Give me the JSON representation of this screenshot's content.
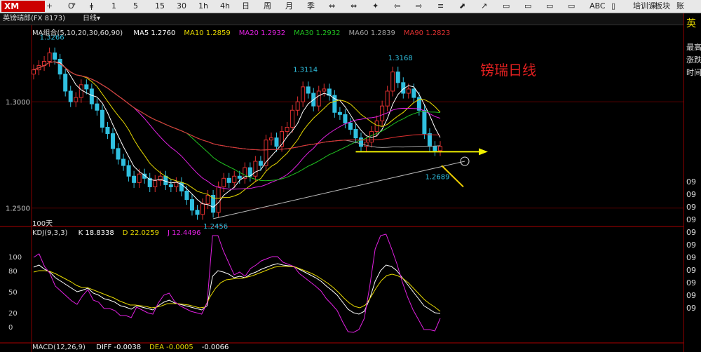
{
  "toolbar": {
    "logo": "XM",
    "items": [
      "+",
      "Ꝍ",
      "ǂ",
      "1",
      "5",
      "15",
      "30",
      "1h",
      "4h",
      "日",
      "周",
      "月",
      "季",
      "⇔",
      "⇔",
      "✦",
      "⇦",
      "⇨",
      "≡",
      "⬈",
      "↗",
      "▭",
      "▭",
      "▭",
      "▭",
      "ABC",
      "▯",
      "培训课",
      "板块",
      "账"
    ]
  },
  "titlebar": {
    "symbol": "英镑瑞郎(FX 8173)",
    "period": "日线▾"
  },
  "ma_legend": {
    "label": "MA组合(5,10,20,30,60,90)",
    "items": [
      {
        "text": "MA5 1.2760",
        "color": "#ffffff"
      },
      {
        "text": "MA10 1.2859",
        "color": "#e6d800"
      },
      {
        "text": "MA20 1.2932",
        "color": "#e020e0"
      },
      {
        "text": "MA30 1.2932",
        "color": "#20c020"
      },
      {
        "text": "MA60 1.2839",
        "color": "#a0a0a0"
      },
      {
        "text": "MA90 1.2823",
        "color": "#e03030"
      }
    ]
  },
  "annotation": {
    "text": "镑瑞日线",
    "color": "#e02020"
  },
  "range_label": "100天",
  "kdj_legend": {
    "label": "KDJ(9,3,3)",
    "items": [
      {
        "text": "K 18.8338",
        "color": "#ffffff"
      },
      {
        "text": "D 22.0259",
        "color": "#e6d800"
      },
      {
        "text": "J 12.4496",
        "color": "#e020e0"
      }
    ]
  },
  "macd_legend": {
    "label": "MACD(12,26,9)",
    "items": [
      {
        "text": "DIFF -0.0038",
        "color": "#ffffff"
      },
      {
        "text": "DEA -0.0005",
        "color": "#e6d800"
      },
      {
        "text": "-0.0066",
        "color": "#ffffff"
      }
    ]
  },
  "right_panel": [
    "英",
    "最高",
    "涨跌",
    "时间",
    "09",
    "09",
    "09",
    "09",
    "09",
    "09",
    "09",
    "09",
    "09",
    "09",
    "09"
  ],
  "chart_data": {
    "type": "candlestick",
    "price_axis": {
      "ticks": [
        1.3,
        1.25
      ],
      "tick_labels": [
        "1.3000",
        "1.2500"
      ],
      "ylim": [
        1.242,
        1.334
      ]
    },
    "price_labels": [
      {
        "text": "1.3266",
        "value": 1.3266,
        "index": 3
      },
      {
        "text": "1.3114",
        "value": 1.3114,
        "index": 51
      },
      {
        "text": "1.3168",
        "value": 1.3168,
        "index": 69
      },
      {
        "text": "1.2689",
        "value": 1.2689,
        "index": 76
      },
      {
        "text": "1.2456",
        "value": 1.2456,
        "index": 34
      }
    ],
    "closes": [
      1.315,
      1.317,
      1.319,
      1.323,
      1.32,
      1.313,
      1.305,
      1.3,
      1.302,
      1.308,
      1.306,
      1.299,
      1.296,
      1.288,
      1.285,
      1.278,
      1.273,
      1.27,
      1.265,
      1.262,
      1.266,
      1.264,
      1.26,
      1.263,
      1.265,
      1.261,
      1.26,
      1.262,
      1.258,
      1.254,
      1.249,
      1.247,
      1.252,
      1.256,
      1.248,
      1.26,
      1.264,
      1.262,
      1.265,
      1.264,
      1.269,
      1.265,
      1.272,
      1.27,
      1.282,
      1.283,
      1.279,
      1.286,
      1.288,
      1.296,
      1.3,
      1.307,
      1.304,
      1.298,
      1.305,
      1.306,
      1.303,
      1.295,
      1.294,
      1.29,
      1.287,
      1.283,
      1.279,
      1.281,
      1.286,
      1.291,
      1.298,
      1.305,
      1.314,
      1.309,
      1.304,
      1.306,
      1.302,
      1.296,
      1.285,
      1.279,
      1.277,
      1.279
    ],
    "kdj": {
      "K": [
        85,
        88,
        82,
        78,
        70,
        65,
        60,
        55,
        50,
        52,
        55,
        48,
        45,
        40,
        38,
        35,
        30,
        28,
        25,
        30,
        28,
        26,
        24,
        30,
        35,
        38,
        34,
        32,
        30,
        28,
        26,
        24,
        30,
        72,
        80,
        78,
        75,
        70,
        72,
        70,
        75,
        78,
        82,
        85,
        88,
        90,
        88,
        87,
        86,
        82,
        78,
        74,
        70,
        65,
        58,
        52,
        45,
        35,
        25,
        20,
        18,
        22,
        40,
        65,
        80,
        88,
        86,
        80,
        70,
        60,
        50,
        40,
        30,
        25,
        20,
        19
      ],
      "D": [
        78,
        80,
        80,
        79,
        76,
        72,
        68,
        64,
        59,
        56,
        56,
        53,
        50,
        47,
        44,
        41,
        37,
        34,
        31,
        31,
        30,
        29,
        27,
        28,
        30,
        33,
        33,
        33,
        32,
        31,
        29,
        27,
        28,
        43,
        55,
        63,
        67,
        68,
        69,
        69,
        71,
        73,
        76,
        79,
        82,
        85,
        86,
        86,
        86,
        85,
        82,
        79,
        76,
        72,
        67,
        62,
        56,
        49,
        41,
        34,
        29,
        27,
        31,
        42,
        55,
        66,
        73,
        75,
        73,
        69,
        63,
        55,
        47,
        39,
        33,
        28,
        22
      ],
      "J": [
        99,
        104,
        86,
        76,
        58,
        51,
        44,
        37,
        32,
        44,
        53,
        38,
        35,
        26,
        26,
        23,
        16,
        16,
        13,
        28,
        24,
        20,
        18,
        34,
        45,
        48,
        36,
        30,
        26,
        22,
        20,
        18,
        34,
        130,
        130,
        108,
        91,
        74,
        78,
        72,
        83,
        88,
        94,
        97,
        100,
        100,
        92,
        89,
        86,
        76,
        70,
        64,
        58,
        51,
        40,
        32,
        23,
        7,
        -7,
        -8,
        -4,
        12,
        58,
        111,
        130,
        132,
        112,
        90,
        64,
        42,
        24,
        10,
        -4,
        -4,
        -6,
        12
      ],
      "ticks": [
        100,
        80,
        50,
        20,
        0
      ],
      "tick_labels": [
        "100",
        "80",
        "50",
        "20",
        "0"
      ],
      "ylim": [
        -20,
        130
      ]
    }
  }
}
